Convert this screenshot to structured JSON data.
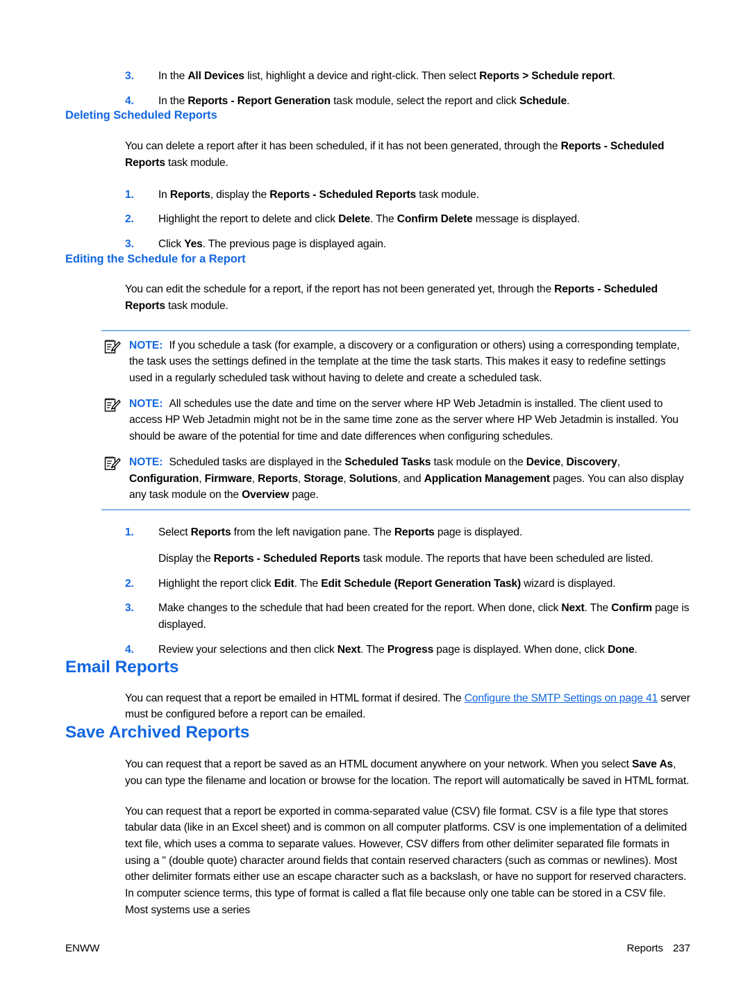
{
  "page": {
    "number": "237",
    "footer_left": "ENWW",
    "footer_right_label": "Reports"
  },
  "steps_top": [
    {
      "num": "3.",
      "parts": [
        {
          "t": "In the ",
          "b": false
        },
        {
          "t": "All Devices",
          "b": true
        },
        {
          "t": " list, highlight a device and right-click. Then select ",
          "b": false
        },
        {
          "t": "Reports > Schedule report",
          "b": true
        },
        {
          "t": ".",
          "b": false
        }
      ]
    },
    {
      "num": "4.",
      "parts": [
        {
          "t": "In the ",
          "b": false
        },
        {
          "t": "Reports - Report Generation",
          "b": true
        },
        {
          "t": " task module, select the report and click ",
          "b": false
        },
        {
          "t": "Schedule",
          "b": true
        },
        {
          "t": ".",
          "b": false
        }
      ]
    }
  ],
  "section_deleting": {
    "heading": "Deleting Scheduled Reports",
    "intro_parts": [
      {
        "t": "You can delete a report after it has been scheduled, if it has not been generated, through the ",
        "b": false
      },
      {
        "t": "Reports - Scheduled Reports",
        "b": true
      },
      {
        "t": " task module.",
        "b": false
      }
    ],
    "steps": [
      {
        "num": "1.",
        "parts": [
          {
            "t": "In ",
            "b": false
          },
          {
            "t": "Reports",
            "b": true
          },
          {
            "t": ", display the ",
            "b": false
          },
          {
            "t": "Reports - Scheduled Reports",
            "b": true
          },
          {
            "t": " task module.",
            "b": false
          }
        ]
      },
      {
        "num": "2.",
        "parts": [
          {
            "t": "Highlight the report to delete and click ",
            "b": false
          },
          {
            "t": "Delete",
            "b": true
          },
          {
            "t": ". The ",
            "b": false
          },
          {
            "t": "Confirm Delete",
            "b": true
          },
          {
            "t": " message is displayed.",
            "b": false
          }
        ]
      },
      {
        "num": "3.",
        "parts": [
          {
            "t": "Click ",
            "b": false
          },
          {
            "t": "Yes",
            "b": true
          },
          {
            "t": ". The previous page is displayed again.",
            "b": false
          }
        ]
      }
    ]
  },
  "section_editing": {
    "heading": "Editing the Schedule for a Report",
    "intro_parts": [
      {
        "t": "You can edit the schedule for a report, if the report has not been generated yet, through the ",
        "b": false
      },
      {
        "t": "Reports - Scheduled Reports",
        "b": true
      },
      {
        "t": " task module.",
        "b": false
      }
    ],
    "notes": [
      {
        "label": "NOTE:",
        "icon": "note-pad-pencil-icon",
        "parts": [
          {
            "t": "If you schedule a task (for example, a discovery or a configuration or others) using a corresponding template, the task uses the settings defined in the template at the time the task starts. This makes it easy to redefine settings used in a regularly scheduled task without having to delete and create a scheduled task.",
            "b": false
          }
        ]
      },
      {
        "label": "NOTE:",
        "icon": "note-pad-pencil-icon",
        "parts": [
          {
            "t": "All schedules use the date and time on the server where HP Web Jetadmin is installed. The client used to access HP Web Jetadmin might not be in the same time zone as the server where HP Web Jetadmin is installed. You should be aware of the potential for time and date differences when configuring schedules.",
            "b": false
          }
        ]
      },
      {
        "label": "NOTE:",
        "icon": "note-pad-pencil-icon",
        "parts": [
          {
            "t": "Scheduled tasks are displayed in the ",
            "b": false
          },
          {
            "t": "Scheduled Tasks",
            "b": true
          },
          {
            "t": " task module on the ",
            "b": false
          },
          {
            "t": "Device",
            "b": true
          },
          {
            "t": ", ",
            "b": false
          },
          {
            "t": "Discovery",
            "b": true
          },
          {
            "t": ", ",
            "b": false
          },
          {
            "t": "Configuration",
            "b": true
          },
          {
            "t": ", ",
            "b": false
          },
          {
            "t": "Firmware",
            "b": true
          },
          {
            "t": ", ",
            "b": false
          },
          {
            "t": "Reports",
            "b": true
          },
          {
            "t": ", ",
            "b": false
          },
          {
            "t": "Storage",
            "b": true
          },
          {
            "t": ", ",
            "b": false
          },
          {
            "t": "Solutions",
            "b": true
          },
          {
            "t": ", and ",
            "b": false
          },
          {
            "t": "Application Management",
            "b": true
          },
          {
            "t": " pages. You can also display any task module on the ",
            "b": false
          },
          {
            "t": "Overview",
            "b": true
          },
          {
            "t": " page.",
            "b": false
          }
        ]
      }
    ],
    "steps": [
      {
        "num": "1.",
        "parts": [
          {
            "t": "Select ",
            "b": false
          },
          {
            "t": "Reports",
            "b": true
          },
          {
            "t": " from the left navigation pane. The ",
            "b": false
          },
          {
            "t": "Reports",
            "b": true
          },
          {
            "t": " page is displayed.",
            "b": false
          }
        ],
        "sub_parts": [
          {
            "t": "Display the ",
            "b": false
          },
          {
            "t": "Reports - Scheduled Reports",
            "b": true
          },
          {
            "t": " task module. The reports that have been scheduled are listed.",
            "b": false
          }
        ]
      },
      {
        "num": "2.",
        "parts": [
          {
            "t": "Highlight the report click ",
            "b": false
          },
          {
            "t": "Edit",
            "b": true
          },
          {
            "t": ". The ",
            "b": false
          },
          {
            "t": "Edit Schedule (Report Generation Task)",
            "b": true
          },
          {
            "t": " wizard is displayed.",
            "b": false
          }
        ]
      },
      {
        "num": "3.",
        "parts": [
          {
            "t": "Make changes to the schedule that had been created for the report. When done, click ",
            "b": false
          },
          {
            "t": "Next",
            "b": true
          },
          {
            "t": ". The ",
            "b": false
          },
          {
            "t": "Confirm",
            "b": true
          },
          {
            "t": " page is displayed.",
            "b": false
          }
        ]
      },
      {
        "num": "4.",
        "parts": [
          {
            "t": "Review your selections and then click ",
            "b": false
          },
          {
            "t": "Next",
            "b": true
          },
          {
            "t": ". The ",
            "b": false
          },
          {
            "t": "Progress",
            "b": true
          },
          {
            "t": " page is displayed. When done, click ",
            "b": false
          },
          {
            "t": "Done",
            "b": true
          },
          {
            "t": ".",
            "b": false
          }
        ]
      }
    ]
  },
  "section_email": {
    "heading": "Email Reports",
    "body_parts": [
      {
        "t": "You can request that a report be emailed in HTML format if desired. The ",
        "b": false
      },
      {
        "t": "Configure the SMTP Settings on page 41",
        "b": false,
        "link": true
      },
      {
        "t": " server must be configured before a report can be emailed.",
        "b": false
      }
    ]
  },
  "section_save": {
    "heading": "Save Archived Reports",
    "para1_parts": [
      {
        "t": "You can request that a report be saved as an HTML document anywhere on your network. When you select ",
        "b": false
      },
      {
        "t": "Save As",
        "b": true
      },
      {
        "t": ", you can type the filename and location or browse for the location. The report will automatically be saved in HTML format.",
        "b": false
      }
    ],
    "para2_parts": [
      {
        "t": "You can request that a report be exported in comma-separated value (CSV) file format. CSV is a file type that stores tabular data (like in an Excel sheet) and is common on all computer platforms. CSV is one implementation of a delimited text file, which uses a comma to separate values. However, CSV differs from other delimiter separated file formats in using a \" (double quote) character around fields that contain reserved characters (such as commas or newlines). Most other delimiter formats either use an escape character such as a backslash, or have no support for reserved characters. In computer science terms, this type of format is called a flat file because only one table can be stored in a CSV file. Most systems use a series",
        "b": false
      }
    ]
  },
  "colors": {
    "heading_blue": "#1267e0",
    "rule_blue": "#7fb2ee",
    "text_black": "#000000"
  }
}
